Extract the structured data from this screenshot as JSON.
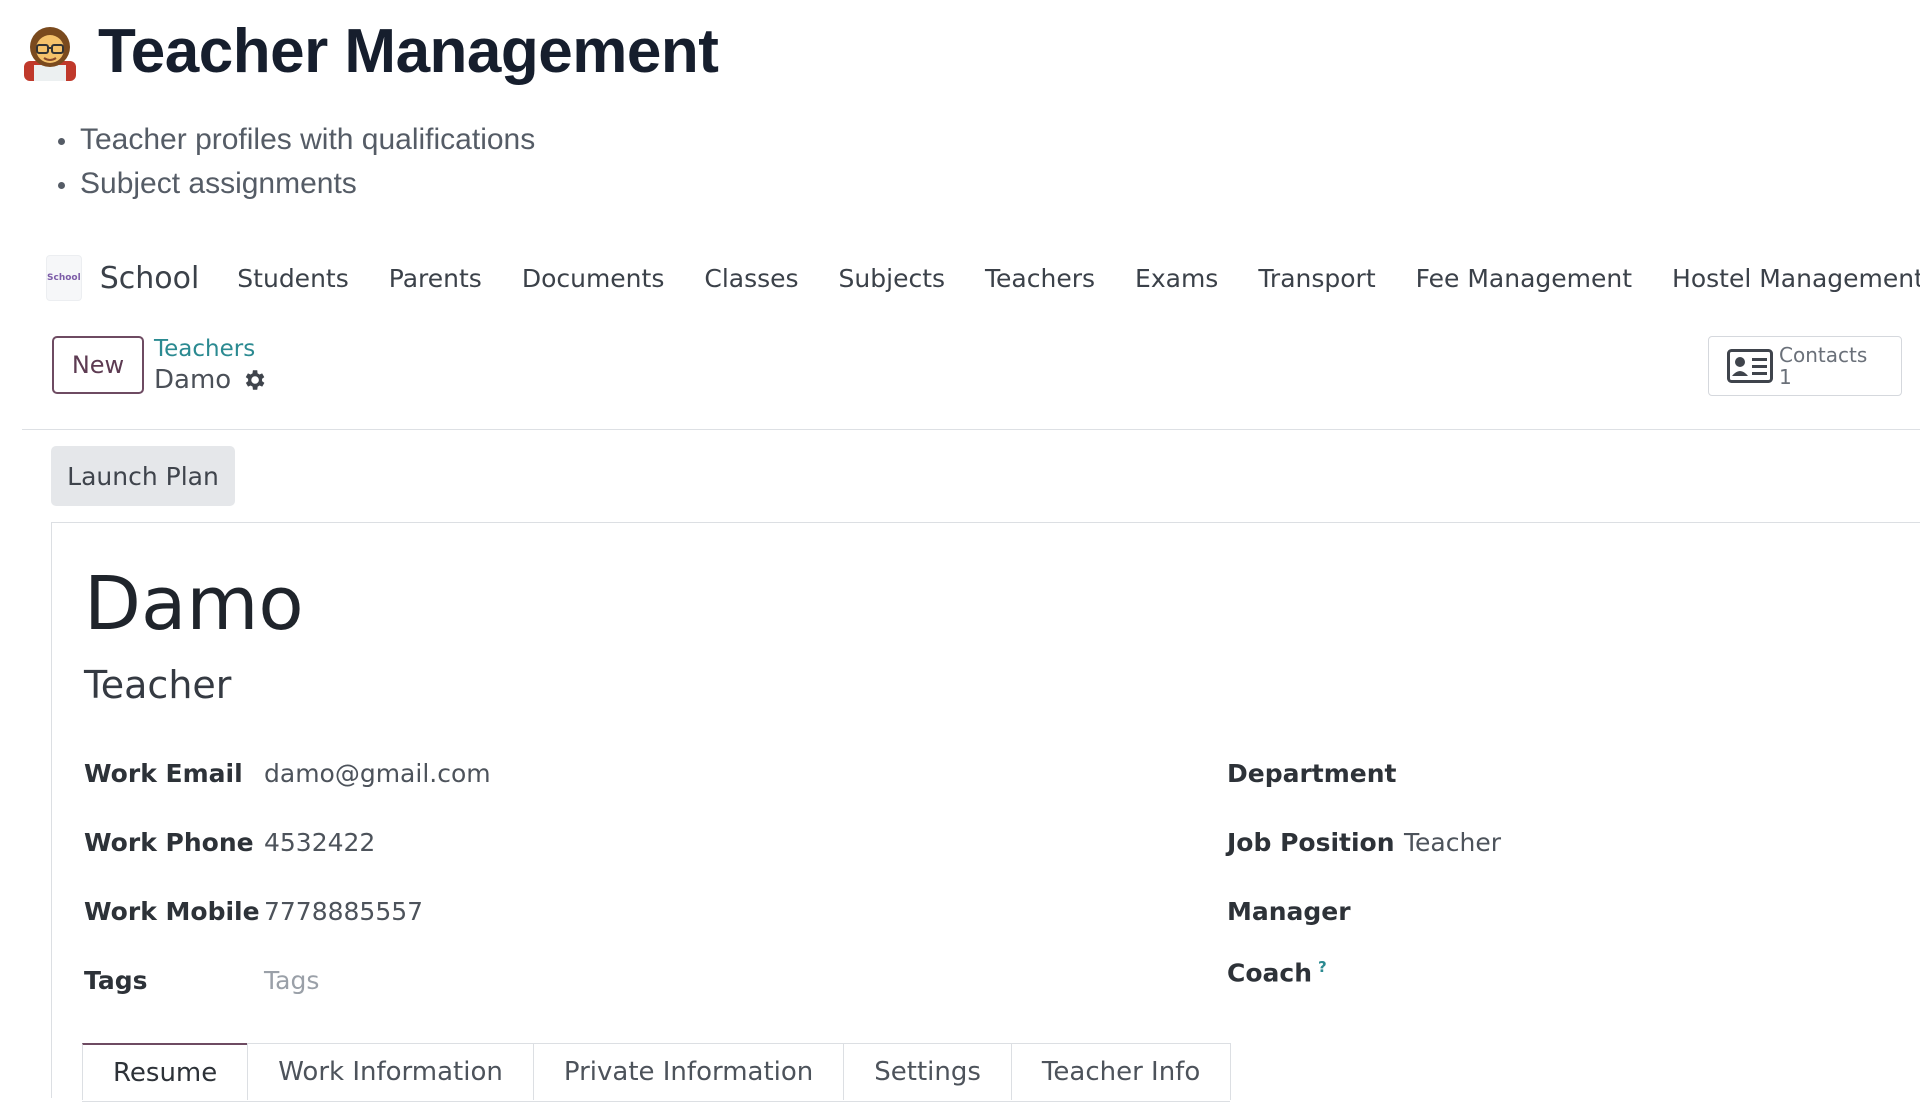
{
  "doc": {
    "title": "Teacher Management",
    "emoji_icon": "teacher-emoji-icon",
    "bullets": [
      "Teacher profiles with qualifications",
      "Subject assignments"
    ]
  },
  "navbar": {
    "logo_text": "School",
    "app_name": "School",
    "menu": [
      "Students",
      "Parents",
      "Documents",
      "Classes",
      "Subjects",
      "Teachers",
      "Exams",
      "Transport",
      "Fee Management",
      "Hostel Management"
    ]
  },
  "control": {
    "new_label": "New",
    "breadcrumb_parent": "Teachers",
    "breadcrumb_current": "Damo",
    "smart_button": {
      "label": "Contacts",
      "count": "1"
    },
    "launch_label": "Launch Plan"
  },
  "form": {
    "name": "Damo",
    "job_title": "Teacher",
    "left_fields": [
      {
        "label": "Work Email",
        "value": "damo@gmail.com"
      },
      {
        "label": "Work Phone",
        "value": "4532422"
      },
      {
        "label": "Work Mobile",
        "value": "7778885557"
      },
      {
        "label": "Tags",
        "placeholder": "Tags"
      }
    ],
    "right_fields": [
      {
        "label": "Department",
        "value": ""
      },
      {
        "label": "Job Position",
        "value": "Teacher"
      },
      {
        "label": "Manager",
        "value": ""
      },
      {
        "label": "Coach",
        "help": "?"
      }
    ],
    "tabs": [
      "Resume",
      "Work Information",
      "Private Information",
      "Settings",
      "Teacher Info"
    ]
  },
  "colors": {
    "primary": "#6e4b62",
    "link": "#2b8a91",
    "title": "#161e2d"
  }
}
